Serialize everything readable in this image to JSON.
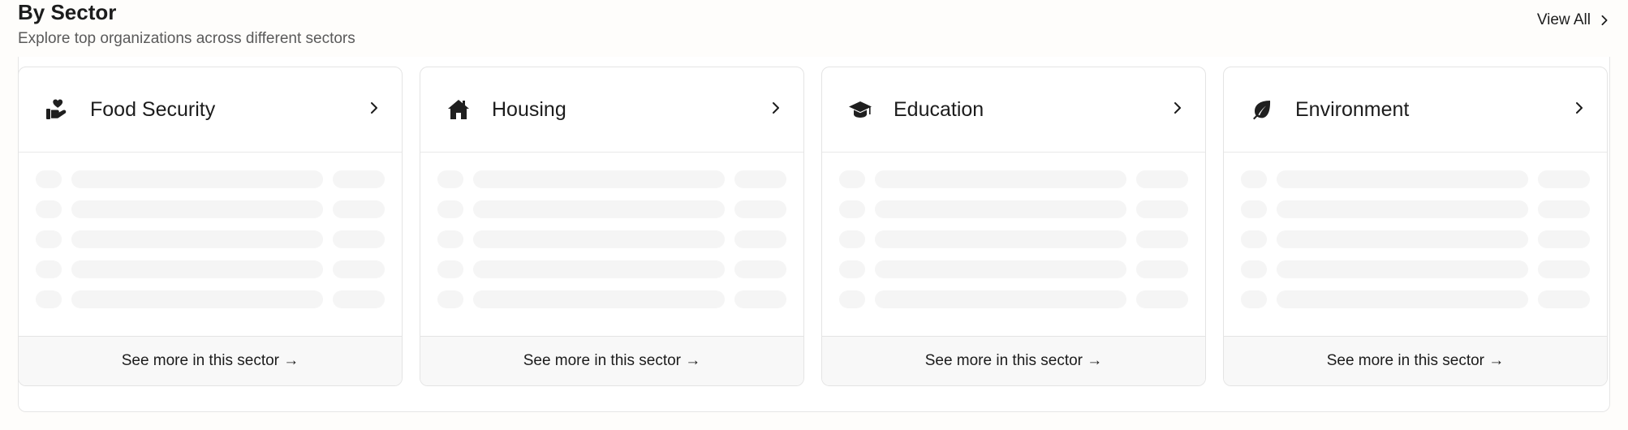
{
  "header": {
    "title": "By Sector",
    "subtitle": "Explore top organizations across different sectors",
    "view_all_label": "View All"
  },
  "sectors": [
    {
      "title": "Food Security",
      "icon": "hand-heart-icon",
      "footer": "See more in this sector →"
    },
    {
      "title": "Housing",
      "icon": "house-icon",
      "footer": "See more in this sector →"
    },
    {
      "title": "Education",
      "icon": "graduation-cap-icon",
      "footer": "See more in this sector →"
    },
    {
      "title": "Environment",
      "icon": "leaf-icon",
      "footer": "See more in this sector →"
    }
  ],
  "colors": {
    "text": "#1c1c1c",
    "muted": "#5a5a5a",
    "skeleton": "#f5f5f5",
    "border": "#e4e4e4",
    "footer_bg": "#f8f8f8"
  }
}
